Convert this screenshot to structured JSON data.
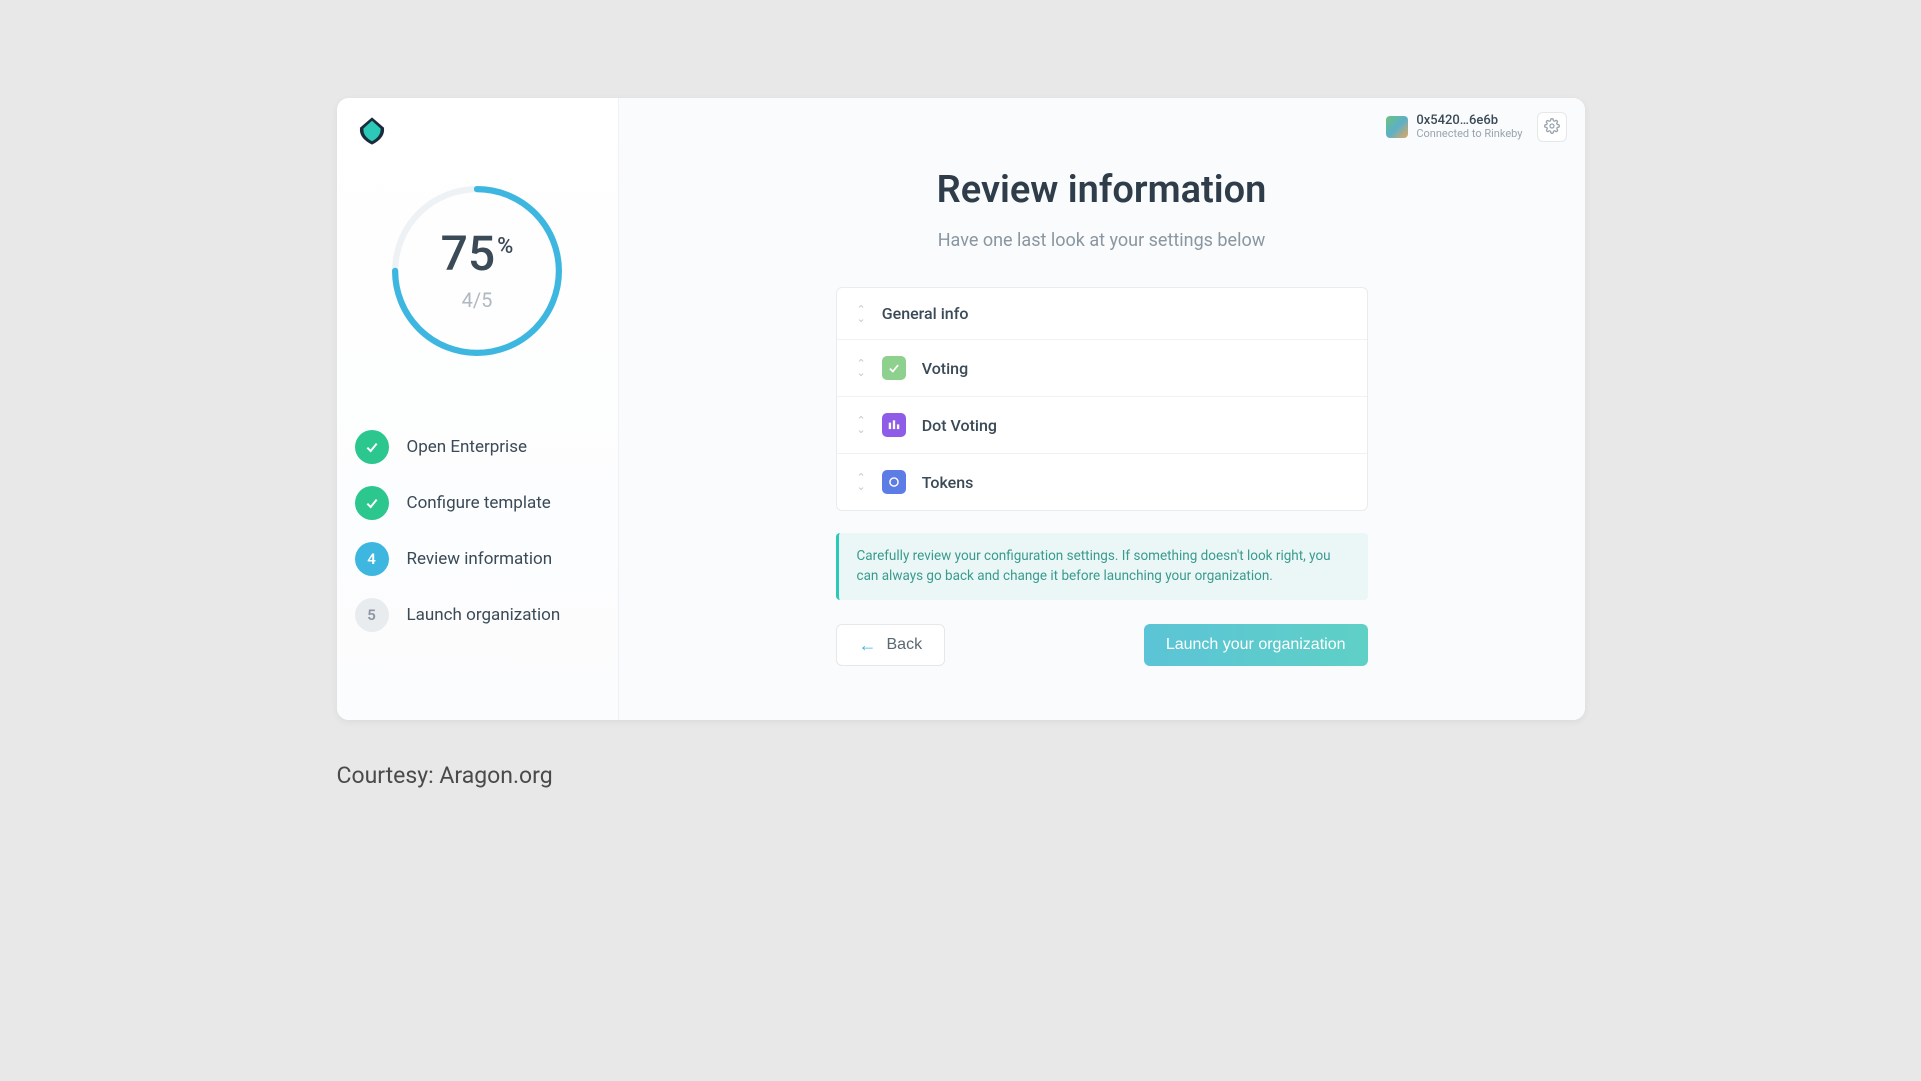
{
  "header": {
    "wallet_address": "0x5420…6e6b",
    "network_status": "Connected to Rinkeby"
  },
  "sidebar": {
    "progress_percent": "75",
    "progress_symbol": "%",
    "progress_fraction": "4/5",
    "steps": [
      {
        "label": "Open Enterprise",
        "state": "done"
      },
      {
        "label": "Configure template",
        "state": "done"
      },
      {
        "label": "Review information",
        "state": "current",
        "number": "4"
      },
      {
        "label": "Launch organization",
        "state": "upcoming",
        "number": "5"
      }
    ]
  },
  "main": {
    "title": "Review information",
    "subtitle": "Have one last look at your settings below",
    "sections": [
      {
        "label": "General info",
        "icon": null
      },
      {
        "label": "Voting",
        "icon": "voting"
      },
      {
        "label": "Dot Voting",
        "icon": "dotvoting"
      },
      {
        "label": "Tokens",
        "icon": "tokens"
      }
    ],
    "info_banner": "Carefully review your configuration settings. If something doesn't look right, you can always go back and change it before launching your organization.",
    "back_label": "Back",
    "launch_label": "Launch your organization"
  },
  "courtesy": "Courtesy: Aragon.org",
  "colors": {
    "accent_teal": "#3eb7e0",
    "success_green": "#2cc68f",
    "banner_teal": "#2cc9b8"
  }
}
